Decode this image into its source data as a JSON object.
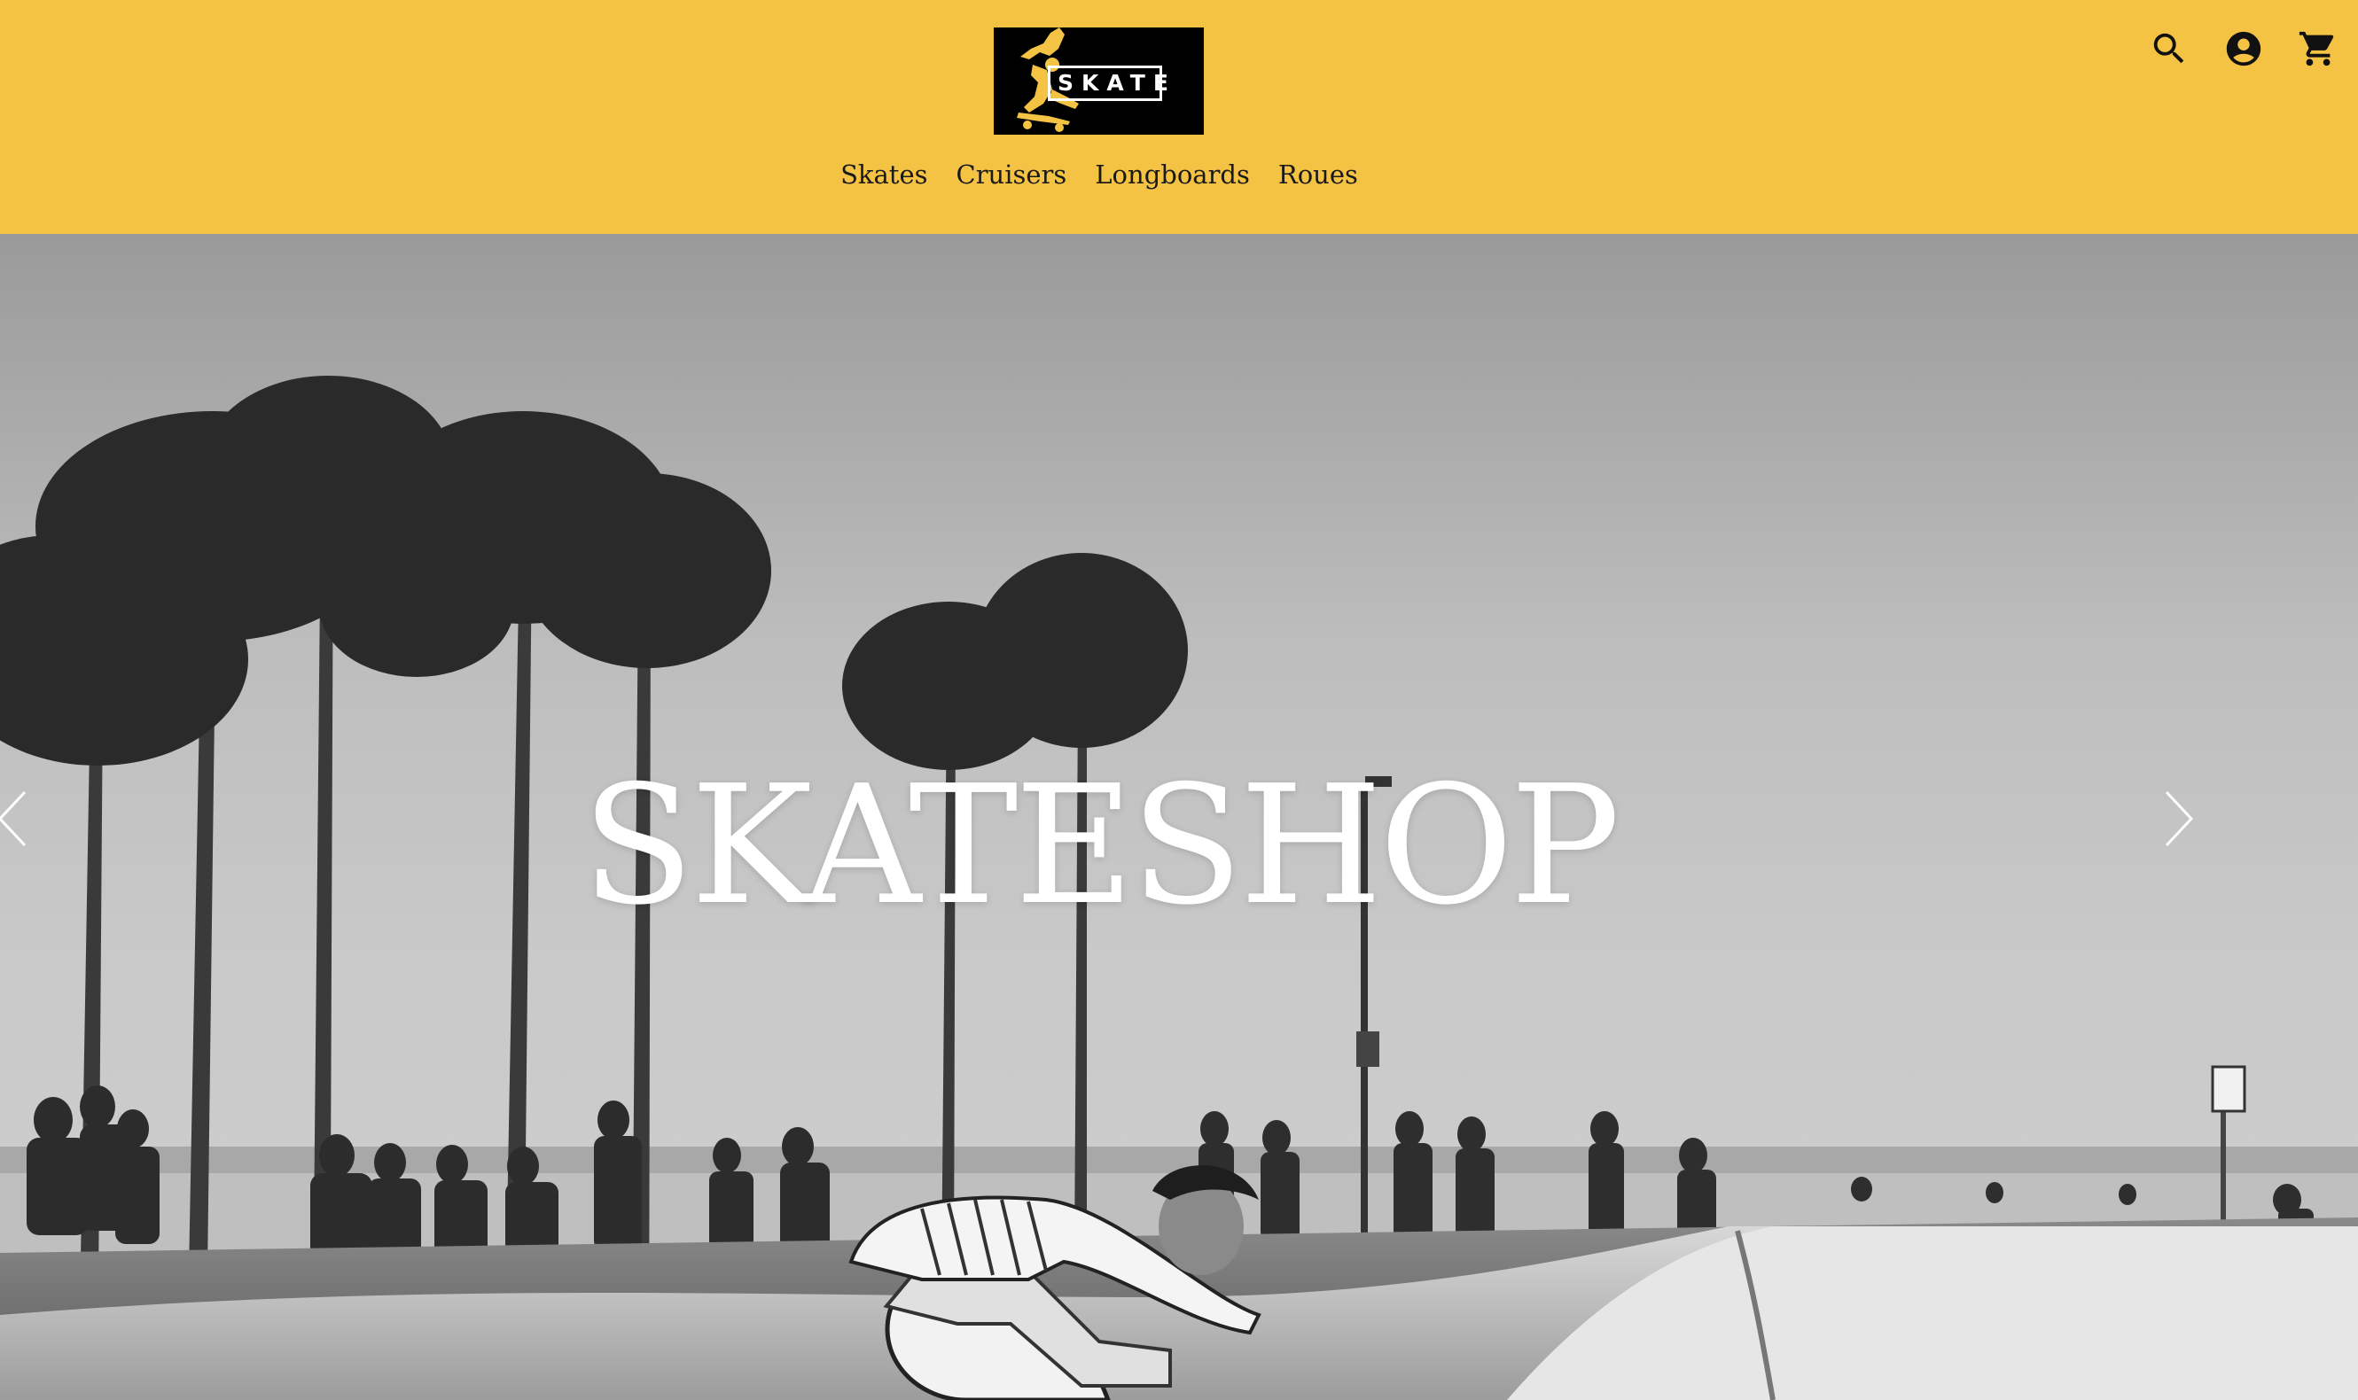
{
  "header": {
    "logo_text": "SKATE",
    "nav": [
      "Skates",
      "Cruisers",
      "Longboards",
      "Roues"
    ],
    "icons": [
      "search-icon",
      "account-icon",
      "cart-icon"
    ]
  },
  "hero": {
    "title": "SKATESHOP",
    "prev_icon": "chevron-left-icon",
    "next_icon": "chevron-right-icon"
  },
  "colors": {
    "brand": "#f5c344",
    "text": "#1a1a1a"
  }
}
